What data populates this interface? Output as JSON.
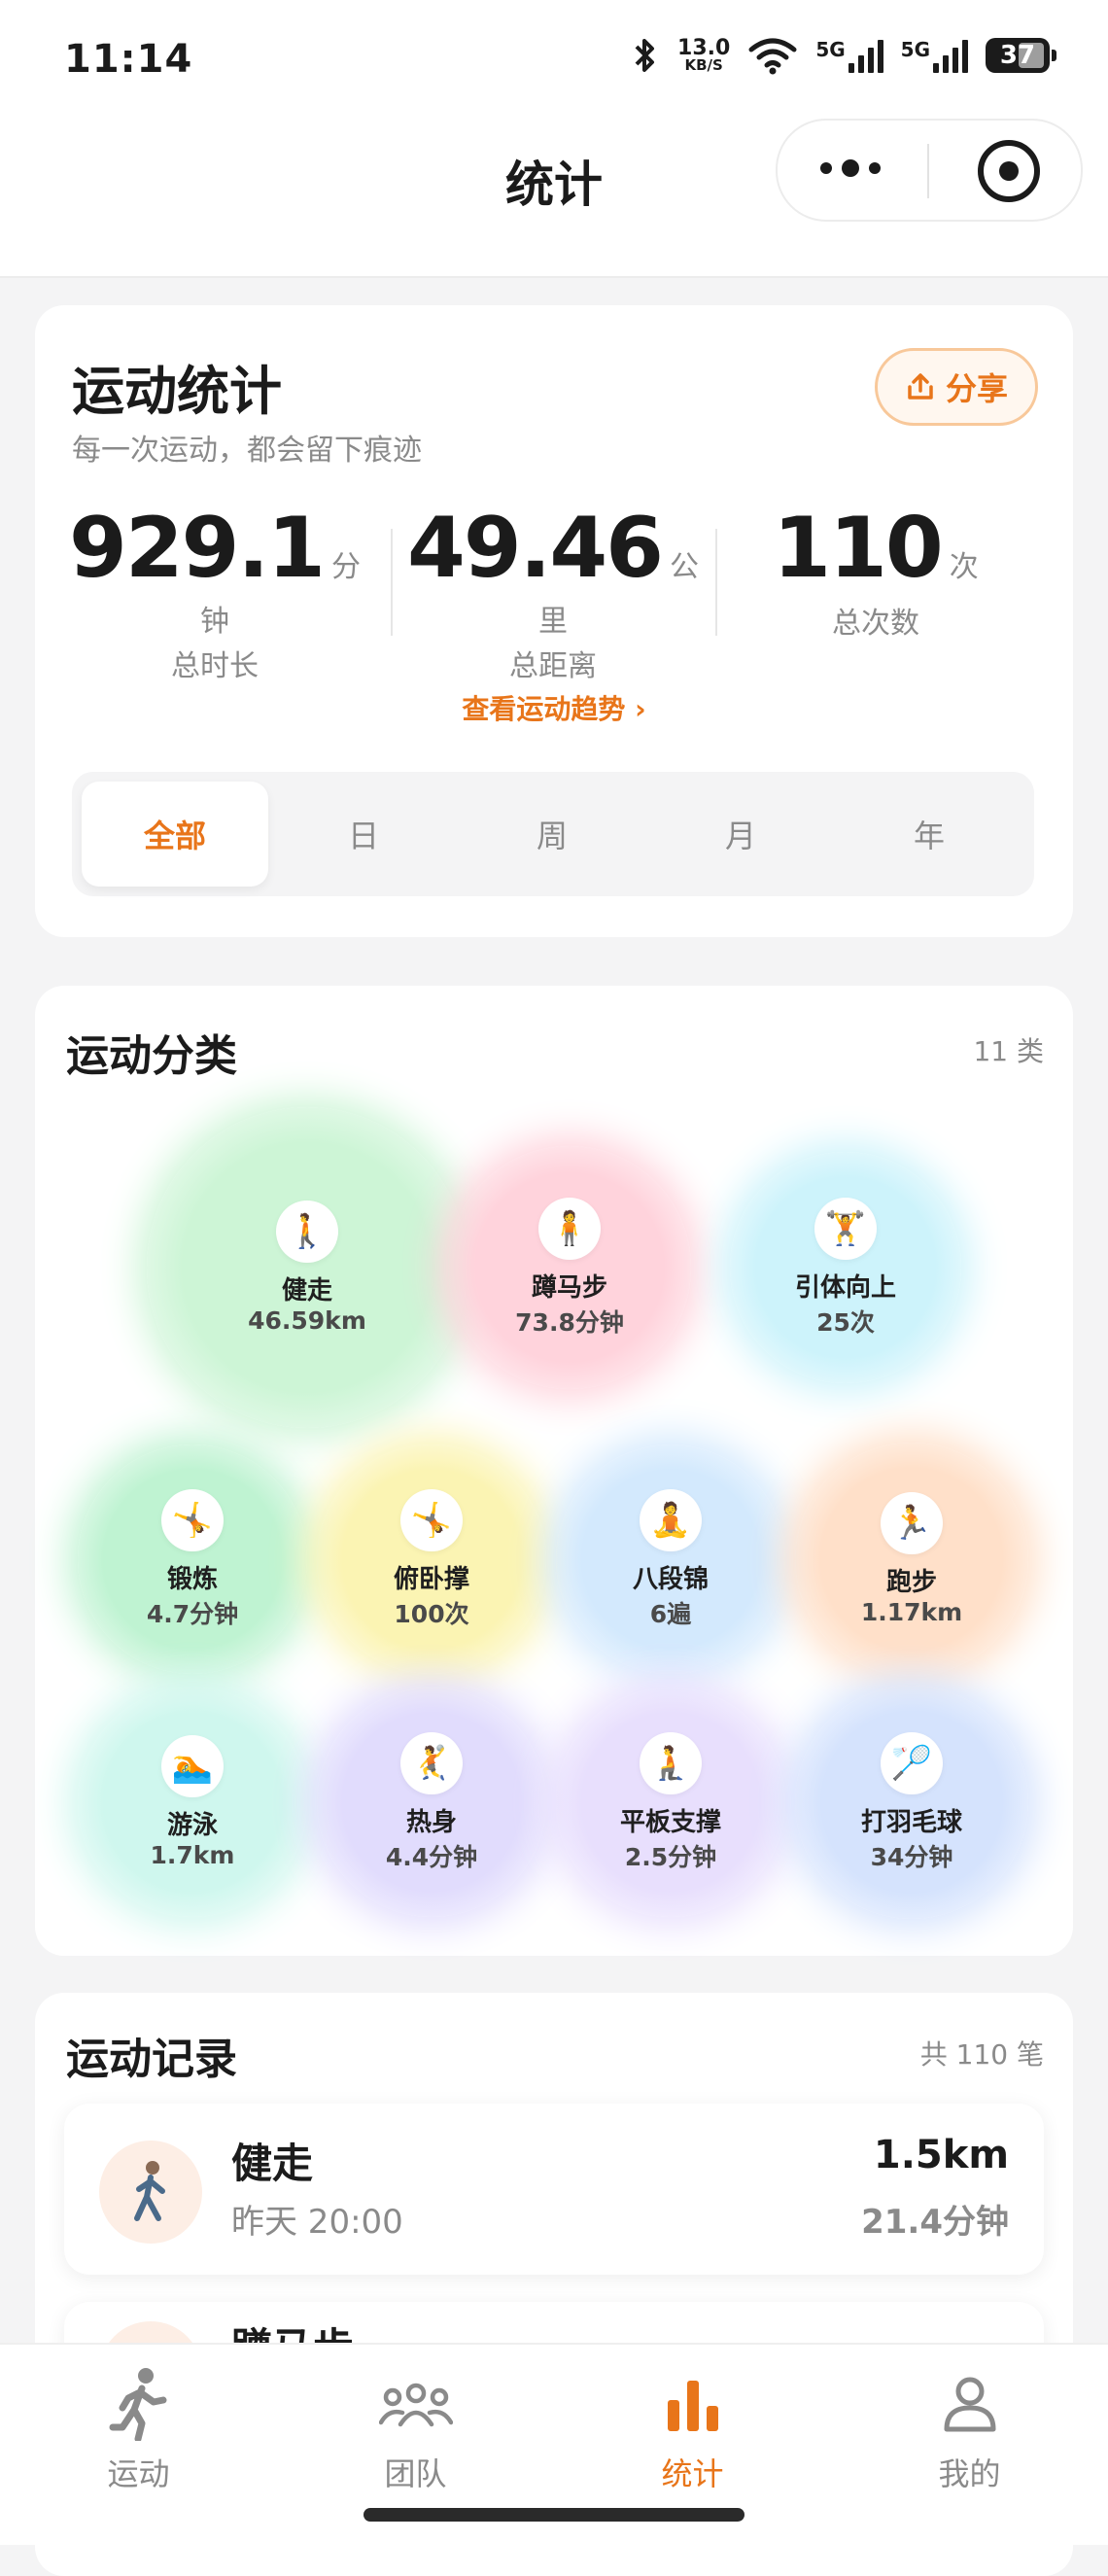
{
  "status": {
    "time": "11:14",
    "net_speed": "13.0",
    "net_unit": "KB/S",
    "sig1": "5G",
    "sig2": "5G",
    "battery": "37"
  },
  "nav": {
    "title": "统计"
  },
  "stats": {
    "title": "运动统计",
    "subtitle": "每一次运动，都会留下痕迹",
    "share": "分享",
    "metrics": [
      {
        "value": "929.1",
        "unit": "分钟",
        "label": "总时长"
      },
      {
        "value": "49.46",
        "unit": "公里",
        "label": "总距离"
      },
      {
        "value": "110",
        "unit": "次",
        "label": "总次数"
      }
    ],
    "trend_link": "查看运动趋势 ›",
    "tabs": [
      "全部",
      "日",
      "周",
      "月",
      "年"
    ],
    "active_tab": "全部"
  },
  "categories": {
    "title": "运动分类",
    "count": "11 类",
    "items": [
      {
        "name": "健走",
        "value": "46.59km",
        "icon": "walk-icon",
        "color": "#cdf5d6"
      },
      {
        "name": "蹲马步",
        "value": "73.8分钟",
        "icon": "squat-icon",
        "color": "#ffd3dc"
      },
      {
        "name": "引体向上",
        "value": "25次",
        "icon": "pullup-icon",
        "color": "#cdf3fb"
      },
      {
        "name": "锻炼",
        "value": "4.7分钟",
        "icon": "workout-icon",
        "color": "#bff3d2"
      },
      {
        "name": "俯卧撑",
        "value": "100次",
        "icon": "pushup-icon",
        "color": "#fbf4b3"
      },
      {
        "name": "八段锦",
        "value": "6遍",
        "icon": "baduanjin-icon",
        "color": "#d3e9fd"
      },
      {
        "name": "跑步",
        "value": "1.17km",
        "icon": "run-icon",
        "color": "#ffe0c9"
      },
      {
        "name": "游泳",
        "value": "1.7km",
        "icon": "swim-icon",
        "color": "#cff7ee"
      },
      {
        "name": "热身",
        "value": "4.4分钟",
        "icon": "warmup-icon",
        "color": "#e1dcfd"
      },
      {
        "name": "平板支撑",
        "value": "2.5分钟",
        "icon": "plank-icon",
        "color": "#e8dffd"
      },
      {
        "name": "打羽毛球",
        "value": "34分钟",
        "icon": "badminton-icon",
        "color": "#d5e3fd"
      }
    ]
  },
  "records": {
    "title": "运动记录",
    "count": "共 110 笔",
    "items": [
      {
        "name": "健走",
        "time": "昨天 20:00",
        "distance": "1.5km",
        "duration": "21.4分钟"
      },
      {
        "name": "蹲马步",
        "time": "",
        "distance": "",
        "duration": ""
      }
    ]
  },
  "tabbar": {
    "items": [
      {
        "label": "运动",
        "icon": "runner-icon"
      },
      {
        "label": "团队",
        "icon": "team-icon"
      },
      {
        "label": "统计",
        "icon": "bar-chart-icon"
      },
      {
        "label": "我的",
        "icon": "person-icon"
      }
    ],
    "active": "统计",
    "active_color": "#e8751a"
  }
}
